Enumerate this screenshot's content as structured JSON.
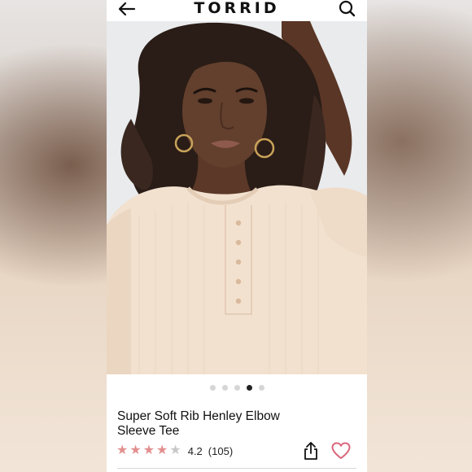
{
  "header": {
    "brand": "TORRID",
    "back_icon": "arrow-left-icon",
    "search_icon": "search-icon"
  },
  "gallery": {
    "total_images": 5,
    "active_index": 3
  },
  "product": {
    "title": "Super Soft Rib Henley Elbow Sleeve Tee",
    "rating_value": "4.2",
    "rating_stars": 4.2,
    "review_count": "(105)"
  },
  "colors": {
    "star_color": "#e38f8f",
    "heart_color": "#d9657a",
    "tee_color": "#f2e1cf"
  }
}
